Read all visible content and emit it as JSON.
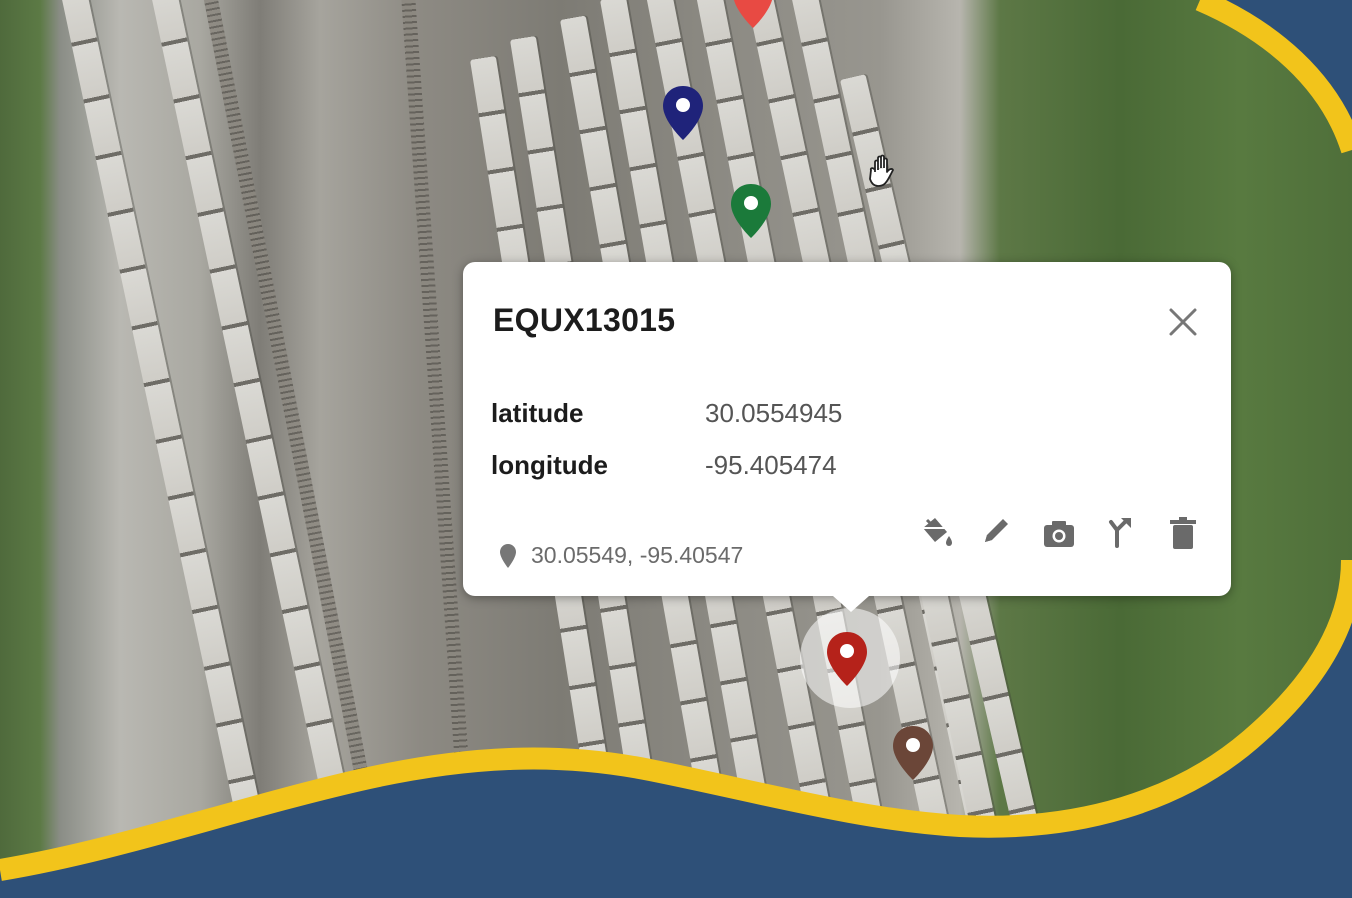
{
  "popup": {
    "title": "EQUX13015",
    "close_icon": "close-icon",
    "properties": [
      {
        "key": "latitude",
        "value": "30.0554945"
      },
      {
        "key": "longitude",
        "value": "-95.405474"
      }
    ],
    "coordinates_icon": "location-pin-icon",
    "coordinates": "30.05549, -95.40547",
    "tools": [
      "paint-bucket-icon",
      "pencil-icon",
      "camera-icon",
      "directions-icon",
      "trash-icon"
    ]
  },
  "markers": [
    {
      "name": "red-marker-top",
      "color": "#e84a43"
    },
    {
      "name": "navy-marker",
      "color": "#1f237a"
    },
    {
      "name": "green-marker",
      "color": "#1b7a3a"
    },
    {
      "name": "red-marker-selected",
      "color": "#b5221a"
    },
    {
      "name": "brown-marker",
      "color": "#6b4638"
    }
  ],
  "colors": {
    "frame_blue": "#2e5078",
    "frame_yellow": "#f2c41b"
  }
}
